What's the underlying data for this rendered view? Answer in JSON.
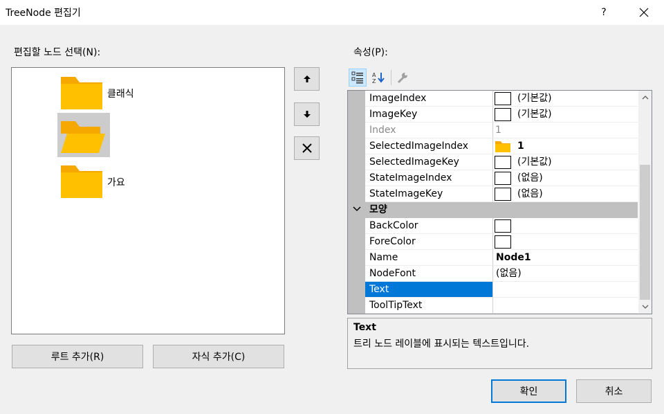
{
  "window": {
    "title": "TreeNode 편집기",
    "help": "?"
  },
  "left": {
    "label": "편집할 노드 선택(N):",
    "nodes": [
      {
        "label": "클래식"
      },
      {
        "label": ""
      },
      {
        "label": "가요"
      }
    ],
    "add_root": "루트 추가(R)",
    "add_child": "자식 추가(C)"
  },
  "right": {
    "label": "속성(P):",
    "rows": [
      {
        "name": "ImageIndex",
        "value": "(기본값)"
      },
      {
        "name": "ImageKey",
        "value": "(기본값)"
      },
      {
        "name": "Index",
        "value": "1"
      },
      {
        "name": "SelectedImageIndex",
        "value": "1"
      },
      {
        "name": "SelectedImageKey",
        "value": "(기본값)"
      },
      {
        "name": "StateImageIndex",
        "value": "(없음)"
      },
      {
        "name": "StateImageKey",
        "value": "(없음)"
      }
    ],
    "category": "모양",
    "rows2": [
      {
        "name": "BackColor",
        "value": ""
      },
      {
        "name": "ForeColor",
        "value": ""
      },
      {
        "name": "Name",
        "value": "Node1"
      },
      {
        "name": "NodeFont",
        "value": "(없음)"
      },
      {
        "name": "Text",
        "value": ""
      },
      {
        "name": "ToolTipText",
        "value": ""
      }
    ],
    "description": {
      "title": "Text",
      "text": "트리 노드 레이블에 표시되는 텍스트입니다."
    }
  },
  "footer": {
    "ok": "확인",
    "cancel": "취소"
  },
  "colors": {
    "accent": "#0078d7",
    "folder": "#ffc000",
    "folder_tab": "#f7a800"
  }
}
